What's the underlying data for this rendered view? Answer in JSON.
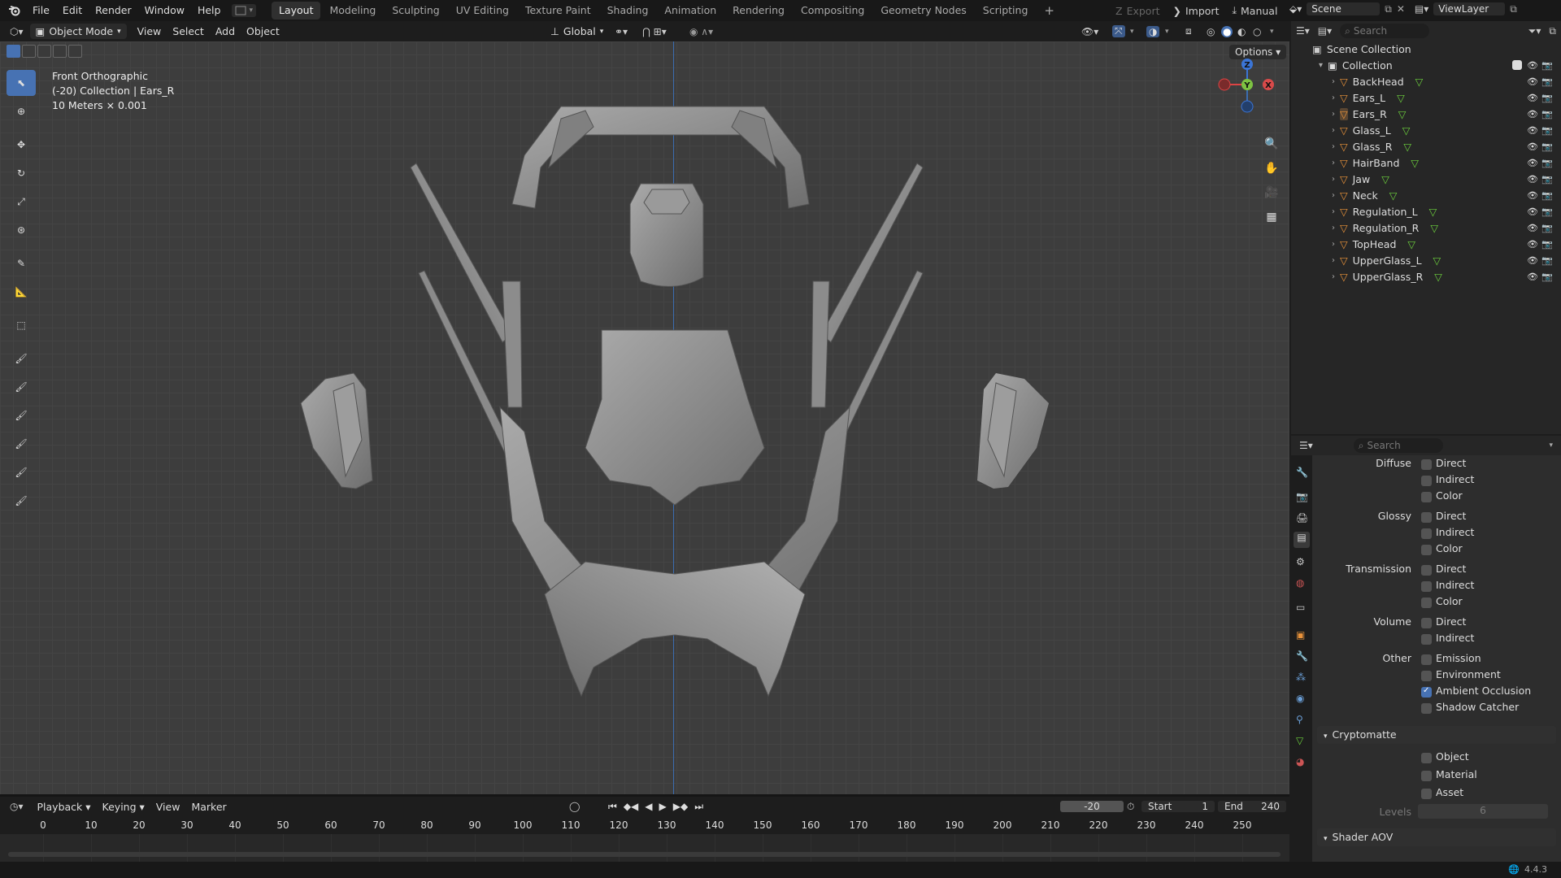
{
  "topbar": {
    "menus": [
      "File",
      "Edit",
      "Render",
      "Window",
      "Help"
    ],
    "workspaces": [
      "Layout",
      "Modeling",
      "Sculpting",
      "UV Editing",
      "Texture Paint",
      "Shading",
      "Animation",
      "Rendering",
      "Compositing",
      "Geometry Nodes",
      "Scripting"
    ],
    "active_workspace": "Layout",
    "add_tab": "+",
    "export_label": "Export",
    "import_label": "Import",
    "manual_label": "Manual",
    "scene_label": "Scene",
    "viewlayer_label": "ViewLayer"
  },
  "viewport_header": {
    "mode": "Object Mode",
    "menus": [
      "View",
      "Select",
      "Add",
      "Object"
    ],
    "transform_orientation": "Global",
    "options_label": "Options"
  },
  "viewport_info": {
    "view_name": "Front Orthographic",
    "collection_line": "(-20) Collection | Ears_R",
    "scale_line": "10 Meters × 0.001"
  },
  "gizmo": {
    "z": "Z",
    "y": "Y",
    "x": "X"
  },
  "outliner": {
    "search_placeholder": "Search",
    "scene_collection": "Scene Collection",
    "collection": "Collection",
    "items": [
      "BackHead",
      "Ears_L",
      "Ears_R",
      "Glass_L",
      "Glass_R",
      "HairBand",
      "Jaw",
      "Neck",
      "Regulation_L",
      "Regulation_R",
      "TopHead",
      "UpperGlass_L",
      "UpperGlass_R"
    ],
    "selected_item": "Ears_R"
  },
  "properties": {
    "search_placeholder": "Search",
    "light_passes": [
      {
        "group": "Diffuse",
        "options": [
          {
            "label": "Direct",
            "checked": false
          },
          {
            "label": "Indirect",
            "checked": false
          },
          {
            "label": "Color",
            "checked": false
          }
        ]
      },
      {
        "group": "Glossy",
        "options": [
          {
            "label": "Direct",
            "checked": false
          },
          {
            "label": "Indirect",
            "checked": false
          },
          {
            "label": "Color",
            "checked": false
          }
        ]
      },
      {
        "group": "Transmission",
        "options": [
          {
            "label": "Direct",
            "checked": false
          },
          {
            "label": "Indirect",
            "checked": false
          },
          {
            "label": "Color",
            "checked": false
          }
        ]
      },
      {
        "group": "Volume",
        "options": [
          {
            "label": "Direct",
            "checked": false
          },
          {
            "label": "Indirect",
            "checked": false
          }
        ]
      },
      {
        "group": "Other",
        "options": [
          {
            "label": "Emission",
            "checked": false
          },
          {
            "label": "Environment",
            "checked": false
          },
          {
            "label": "Ambient Occlusion",
            "checked": true
          },
          {
            "label": "Shadow Catcher",
            "checked": false
          }
        ]
      }
    ],
    "cryptomatte_title": "Cryptomatte",
    "cryptomatte_options": [
      {
        "label": "Object",
        "checked": false
      },
      {
        "label": "Material",
        "checked": false
      },
      {
        "label": "Asset",
        "checked": false
      }
    ],
    "levels_label": "Levels",
    "levels_value": "6",
    "shader_aov_title": "Shader AOV"
  },
  "timeline": {
    "menus": [
      "Playback",
      "Keying",
      "View",
      "Marker"
    ],
    "current_frame": "-20",
    "start_label": "Start",
    "start_value": "1",
    "end_label": "End",
    "end_value": "240",
    "ticks": [
      "0",
      "10",
      "20",
      "30",
      "40",
      "50",
      "60",
      "70",
      "80",
      "90",
      "100",
      "110",
      "120",
      "130",
      "140",
      "150",
      "160",
      "170",
      "180",
      "190",
      "200",
      "210",
      "220",
      "230",
      "240",
      "250"
    ]
  },
  "statusbar": {
    "version": "4.4.3"
  },
  "colors": {
    "accent": "#4772b3",
    "object_orange": "#e8923a",
    "mesh_green": "#6ccf3d"
  }
}
